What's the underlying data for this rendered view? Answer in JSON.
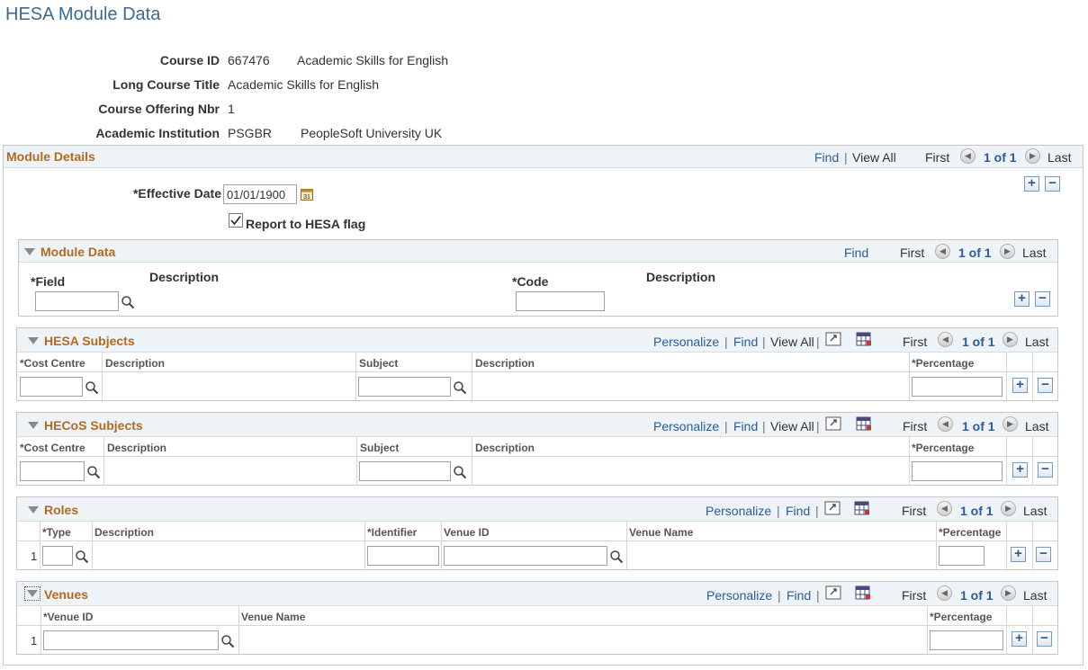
{
  "page": {
    "title": "HESA Module Data"
  },
  "course": {
    "course_id_label": "Course ID",
    "course_id": "667476",
    "course_desc": "Academic Skills for English",
    "long_title_label": "Long Course Title",
    "long_title": "Academic Skills for English",
    "offering_label": "Course Offering Nbr",
    "offering": "1",
    "institution_label": "Academic Institution",
    "institution_code": "PSGBR",
    "institution_name": "PeopleSoft University UK"
  },
  "module_details": {
    "title": "Module Details",
    "find": "Find",
    "sep": "|",
    "view_all": "View All",
    "first": "First",
    "count": "1 of 1",
    "last": "Last",
    "effective_date_label": "*Effective Date",
    "effective_date": "01/01/1900",
    "report_flag_label": "Report to HESA flag",
    "report_flag_checked": true
  },
  "module_data": {
    "title": "Module Data",
    "find": "Find",
    "first": "First",
    "count": "1 of 1",
    "last": "Last",
    "field_label": "*Field",
    "desc1_label": "Description",
    "code_label": "*Code",
    "desc2_label": "Description",
    "field_value": "",
    "code_value": ""
  },
  "hesa_subjects": {
    "title": "HESA Subjects",
    "personalize": "Personalize",
    "find": "Find",
    "view_all": "View All",
    "sep": "|",
    "first": "First",
    "count": "1 of 1",
    "last": "Last",
    "columns": [
      "*Cost Centre",
      "Description",
      "Subject",
      "Description",
      "*Percentage"
    ]
  },
  "hecos_subjects": {
    "title": "HECoS Subjects",
    "personalize": "Personalize",
    "find": "Find",
    "view_all": "View All",
    "sep": "|",
    "first": "First",
    "count": "1 of 1",
    "last": "Last",
    "columns": [
      "*Cost Centre",
      "Description",
      "Subject",
      "Description",
      "*Percentage"
    ]
  },
  "roles": {
    "title": "Roles",
    "personalize": "Personalize",
    "find": "Find",
    "sep": "|",
    "first": "First",
    "count": "1 of 1",
    "last": "Last",
    "columns": [
      "*Type",
      "Description",
      "*Identifier",
      "Venue ID",
      "Venue Name",
      "*Percentage"
    ],
    "row_num": "1"
  },
  "venues": {
    "title": "Venues",
    "personalize": "Personalize",
    "find": "Find",
    "sep": "|",
    "first": "First",
    "count": "1 of 1",
    "last": "Last",
    "columns": [
      "*Venue ID",
      "Venue Name",
      "*Percentage"
    ],
    "row_num": "1"
  },
  "icons": {
    "add": "+",
    "remove": "−",
    "prev": "◀",
    "next": "▶"
  },
  "colors": {
    "title": "#3a6a92",
    "section_title": "#b36a1e",
    "link": "#2b5b99",
    "header_bar": "#eef3f7"
  }
}
